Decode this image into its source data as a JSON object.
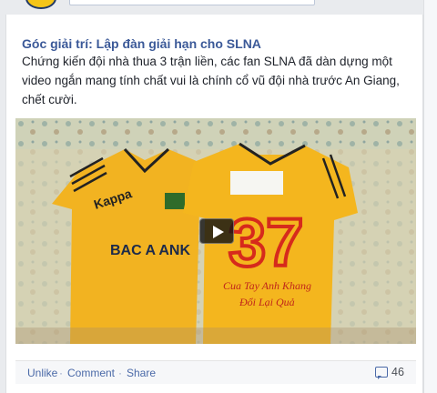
{
  "post": {
    "title": "Góc giải trí: Lập đàn giải hạn cho SLNA",
    "body": "Chứng kiến đội nhà thua 3 trận liền, các fan SLNA đã dàn dựng một video ngắn mang tính chất vui là chính cổ vũ đội nhà trước An Giang, chết cười."
  },
  "photo": {
    "shirt_left_brand": "Kappa",
    "shirt_left_sponsor": "BAC A ANK",
    "shirt_right_number": "37",
    "shirt_right_line1": "Cua Tay Anh Khang",
    "shirt_right_line2": "Đổi Lại Quả"
  },
  "actions": {
    "unlike": "Unlike",
    "dot1": "·",
    "comment": "Comment",
    "dot2": "·",
    "share": "Share",
    "comment_count": "46"
  },
  "colors": {
    "link": "#3b5998",
    "shirt": "#f2b321",
    "number": "#d62a1c"
  }
}
